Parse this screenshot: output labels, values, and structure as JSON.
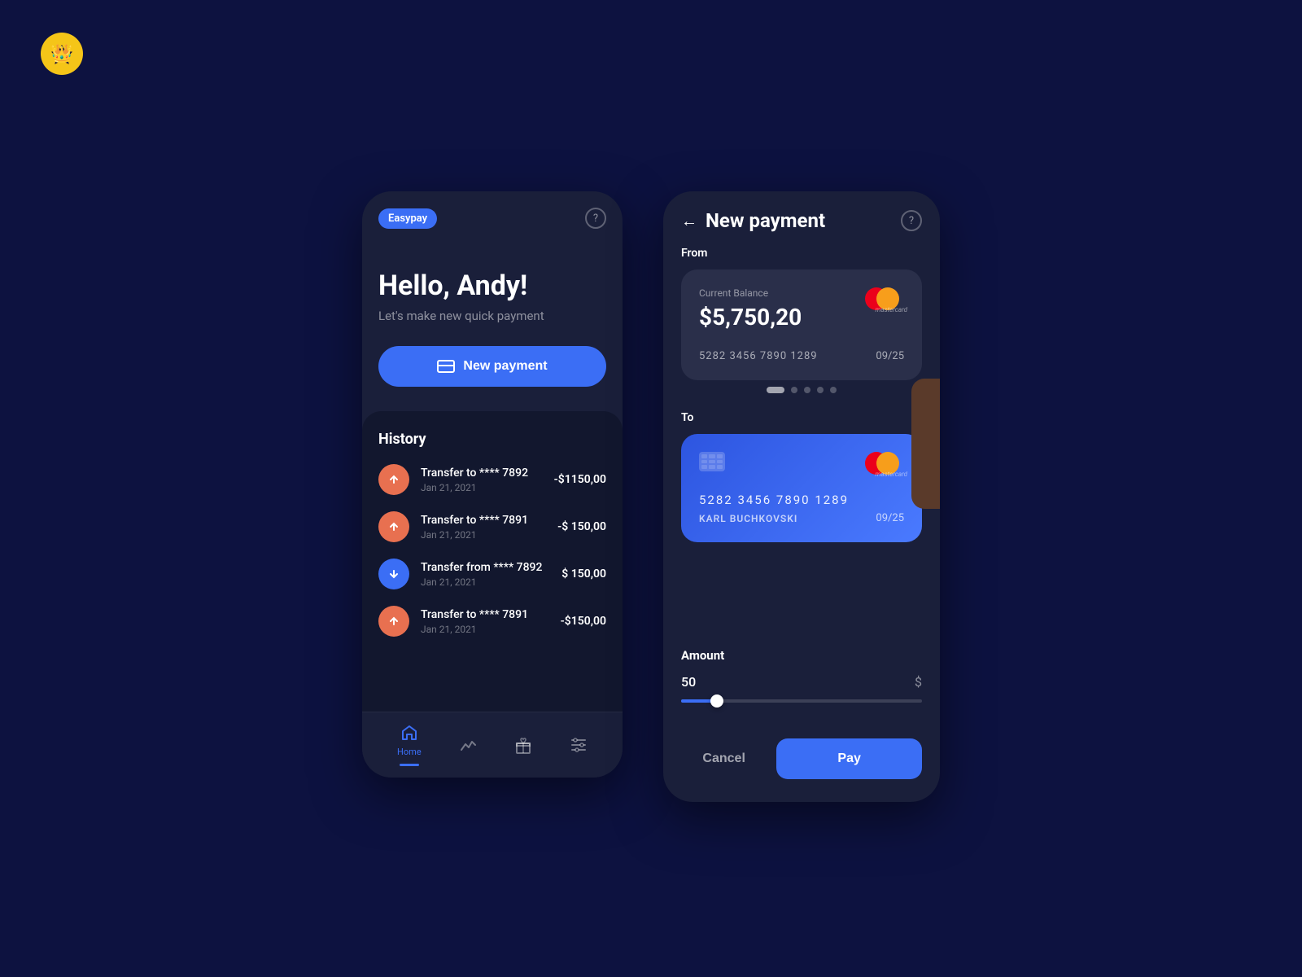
{
  "app": {
    "logo_symbol": "👑",
    "background": "#0d1240"
  },
  "left_screen": {
    "brand": "Easypay",
    "help_icon": "?",
    "hero": {
      "greeting": "Hello, Andy!",
      "subtitle": "Let's make new quick payment",
      "cta_button": "New payment"
    },
    "history": {
      "title": "History",
      "items": [
        {
          "type": "up",
          "label": "Transfer to **** 7892",
          "date": "Jan 21, 2021",
          "amount": "-$1150,00"
        },
        {
          "type": "up",
          "label": "Transfer to **** 7891",
          "date": "Jan 21, 2021",
          "amount": "-$ 150,00"
        },
        {
          "type": "down",
          "label": "Transfer from **** 7892",
          "date": "Jan 21, 2021",
          "amount": "$ 150,00"
        },
        {
          "type": "up",
          "label": "Transfer to **** 7891",
          "date": "Jan 21, 2021",
          "amount": "-$150,00"
        }
      ]
    },
    "nav": {
      "items": [
        {
          "id": "home",
          "label": "Home",
          "active": true
        },
        {
          "id": "chart",
          "label": "",
          "active": false
        },
        {
          "id": "gift",
          "label": "",
          "active": false
        },
        {
          "id": "settings",
          "label": "",
          "active": false
        }
      ]
    }
  },
  "right_screen": {
    "title": "New payment",
    "help_icon": "?",
    "from_label": "From",
    "from_card": {
      "balance_label": "Current Balance",
      "balance": "$5,750,20",
      "number": "5282 3456 7890 1289",
      "expiry": "09/25"
    },
    "dots": [
      true,
      false,
      false,
      false,
      false
    ],
    "to_label": "To",
    "to_card": {
      "number": "5282 3456 7890 1289",
      "holder": "KARL BUCHKOVSKI",
      "expiry": "09/25"
    },
    "amount_label": "Amount",
    "amount_value": "50",
    "amount_currency": "$",
    "slider_percent": 15,
    "cancel_label": "Cancel",
    "pay_label": "Pay"
  }
}
